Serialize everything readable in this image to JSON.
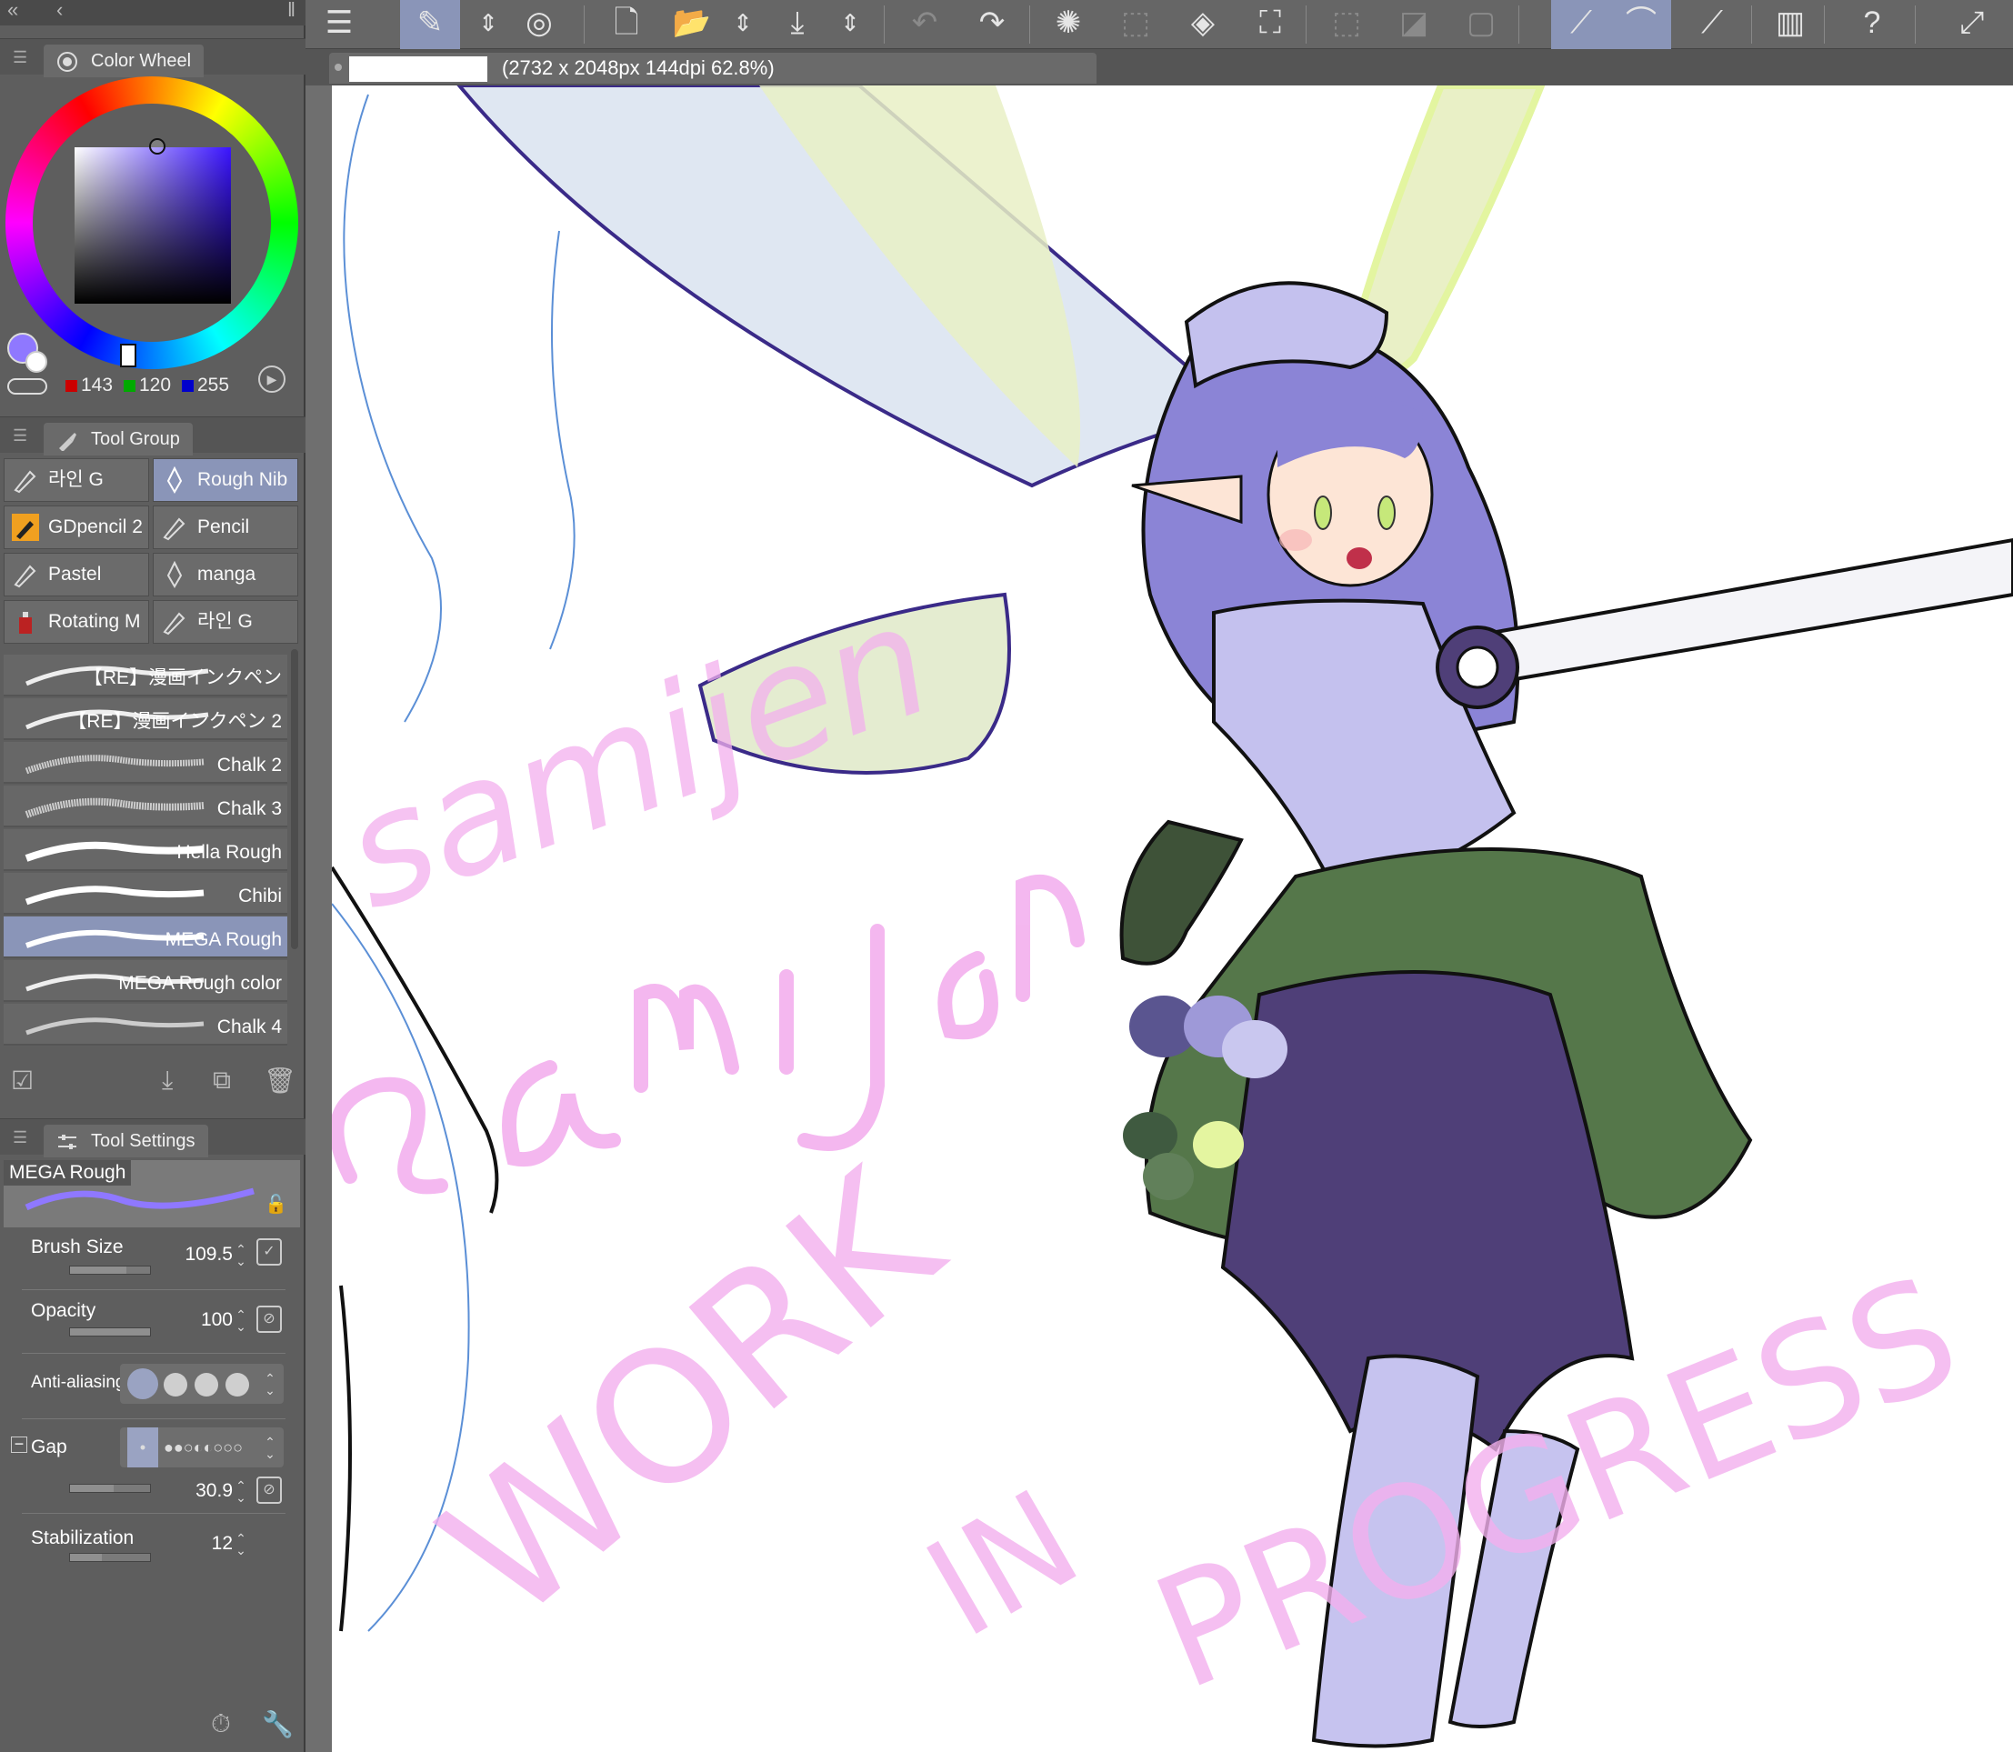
{
  "color_wheel": {
    "title": "Color Wheel",
    "r": "143",
    "g": "120",
    "b": "255",
    "main_color": "#8f78ff"
  },
  "tool_group": {
    "title": "Tool Group",
    "tools": [
      {
        "label": "라인 G",
        "selected": false
      },
      {
        "label": "Rough Nib",
        "selected": true
      },
      {
        "label": "GDpencil 2",
        "selected": false
      },
      {
        "label": "Pencil",
        "selected": false
      },
      {
        "label": "Pastel",
        "selected": false
      },
      {
        "label": "manga",
        "selected": false
      },
      {
        "label": "Rotating M",
        "selected": false
      },
      {
        "label": "라인 G",
        "selected": false
      }
    ]
  },
  "brushes": [
    {
      "label": "【RE】漫画インクペン"
    },
    {
      "label": "【RE】漫画インクペン 2"
    },
    {
      "label": "Chalk 2"
    },
    {
      "label": "Chalk 3"
    },
    {
      "label": "Hella Rough"
    },
    {
      "label": "Chibi"
    },
    {
      "label": "MEGA Rough",
      "selected": true
    },
    {
      "label": "MEGA Rough color"
    },
    {
      "label": "Chalk 4"
    }
  ],
  "tool_settings": {
    "title": "Tool Settings",
    "brush_name": "MEGA Rough",
    "brush_size_label": "Brush Size",
    "brush_size": "109.5",
    "opacity_label": "Opacity",
    "opacity": "100",
    "anti_aliasing_label": "Anti-aliasing",
    "gap_label": "Gap",
    "gap": "30.9",
    "stabilization_label": "Stabilization",
    "stabilization": "12"
  },
  "document": {
    "info": "(2732 x 2048px 144dpi 62.8%)"
  },
  "canvas_text": {
    "signature": "samijen",
    "watermark_1": "WORK",
    "watermark_2": "IN",
    "watermark_3": "PROGRESS"
  },
  "colors": {
    "highlight": "#8a95b8",
    "watermark": "#f3b0ee",
    "hair": "#8b84d6",
    "skirt_green": "#55774a",
    "skirt_purple": "#4f3f78",
    "wing": "#e4edbd"
  }
}
